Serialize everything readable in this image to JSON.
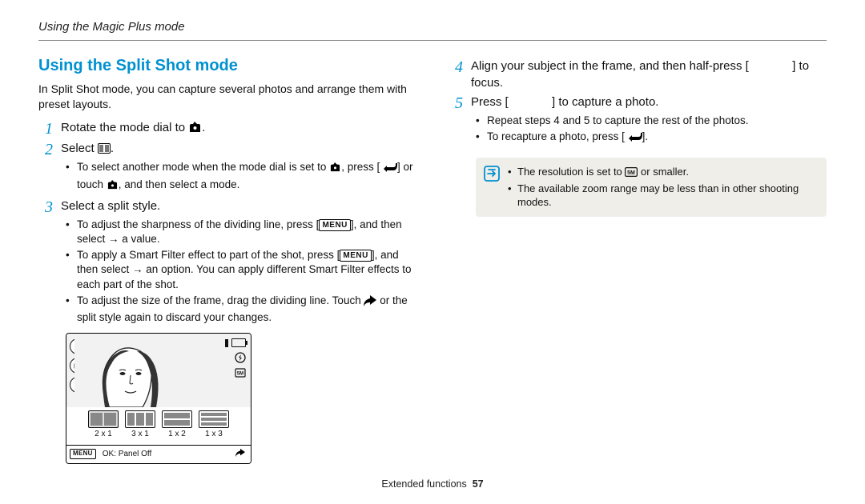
{
  "header": {
    "breadcrumb": "Using the Magic Plus mode"
  },
  "section": {
    "title": "Using the Split Shot mode",
    "intro": "In Split Shot mode, you can capture several photos and arrange them with preset layouts."
  },
  "steps": {
    "s1": {
      "num": "1",
      "text_a": "Rotate the mode dial to ",
      "text_b": "."
    },
    "s2": {
      "num": "2",
      "text_a": "Select ",
      "text_b": ".",
      "sub1_a": "To select another mode when the mode dial is set to ",
      "sub1_b": ", press [",
      "sub1_c": "] or touch ",
      "sub1_d": ", and then select a mode."
    },
    "s3": {
      "num": "3",
      "text": "Select a split style.",
      "sub1_a": "To adjust the sharpness of the dividing line, press [",
      "sub1_b": "], and then select ",
      "sub1_c": " → a value.",
      "sub2_a": "To apply a Smart Filter effect to part of the shot, press [",
      "sub2_b": "], and then select ",
      "sub2_c": " → an option. You can apply different Smart Filter effects to each part of the shot.",
      "sub3_a": "To adjust the size of the frame, drag the dividing line. Touch ",
      "sub3_b": " or the split style again to discard your changes."
    },
    "s4": {
      "num": "4",
      "text_a": "Align your subject in the frame, and then half-press [",
      "text_b": "] to focus."
    },
    "s5": {
      "num": "5",
      "text_a": "Press [",
      "text_b": "] to capture a photo.",
      "sub1": "Repeat steps 4 and 5 to capture the rest of the photos.",
      "sub2_a": "To recapture a photo, press [",
      "sub2_b": "]."
    }
  },
  "screenshot": {
    "labels": {
      "l1": "2 x 1",
      "l2": "3 x 1",
      "l3": "1 x 2",
      "l4": "1 x 3"
    },
    "menu_label": "MENU",
    "bottom_text": "OK: Panel Off"
  },
  "notes": {
    "n1_a": "The resolution is set to ",
    "n1_b": " or smaller.",
    "n2": "The available zoom range may be less than in other shooting modes."
  },
  "labels": {
    "menu": "MENU"
  },
  "footer": {
    "section": "Extended functions",
    "page": "57"
  }
}
